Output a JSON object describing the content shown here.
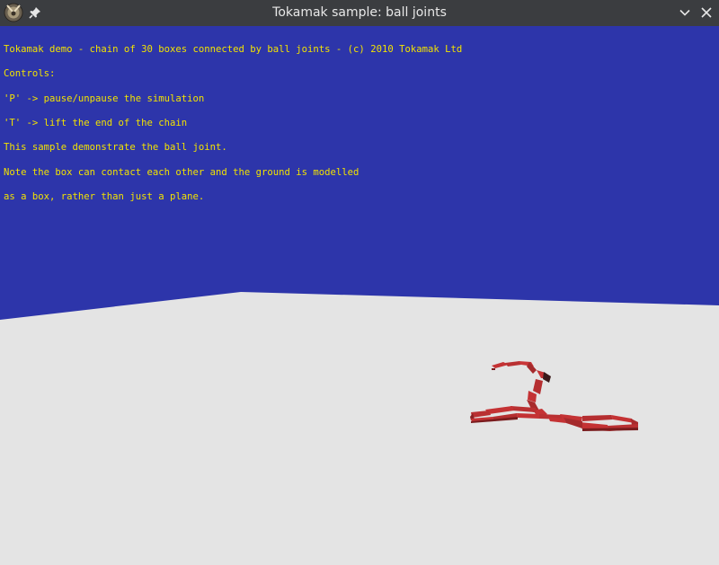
{
  "window": {
    "title": "Tokamak sample: ball joints",
    "icons": {
      "app": "tokamak-app-icon",
      "pin": "pin-icon",
      "minimize": "chevron-down-icon",
      "close": "close-icon"
    }
  },
  "overlay": {
    "lines": [
      "Tokamak demo - chain of 30 boxes connected by ball joints - (c) 2010 Tokamak Ltd",
      "Controls:",
      "'P' -> pause/unpause the simulation",
      "'T' -> lift the end of the chain",
      "This sample demonstrate the ball joint.",
      "Note the box can contact each other and the ground is modelled",
      "as a box, rather than just a plane."
    ]
  },
  "colors": {
    "sky": "#2d35aa",
    "ground": "#e4e4e4",
    "text": "#f2e200",
    "chain": "#c43234",
    "chain_dark": "#7a1c1e",
    "titlebar": "#3b3d40"
  }
}
